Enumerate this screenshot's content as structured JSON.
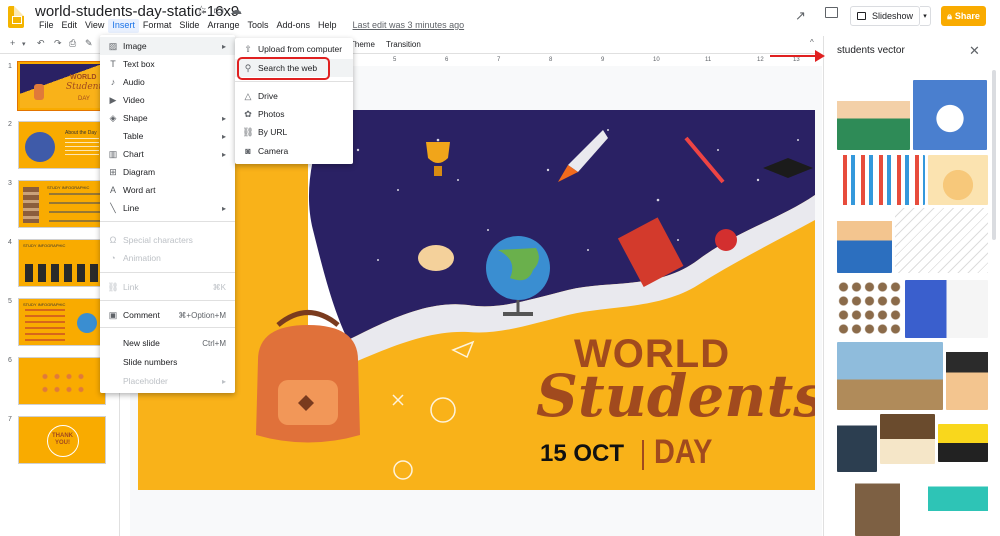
{
  "app": {
    "doc_title": "world-students-day-static-16x9",
    "last_edit": "Last edit was 3 minutes ago",
    "menus": [
      "File",
      "Edit",
      "View",
      "Insert",
      "Format",
      "Slide",
      "Arrange",
      "Tools",
      "Add-ons",
      "Help"
    ],
    "slideshow_label": "Slideshow",
    "share_label": "Share"
  },
  "toolbar": {
    "theme_label": "Theme",
    "transition_label": "Transition"
  },
  "ruler": [
    "5",
    "6",
    "7",
    "8",
    "9",
    "10",
    "11",
    "12",
    "13"
  ],
  "thumbnails": [
    {
      "num": "1",
      "text1": "WORLD",
      "text2": "Students",
      "text3": "DAY"
    },
    {
      "num": "2",
      "text1": "About the Day",
      "text2": "",
      "text3": ""
    },
    {
      "num": "3",
      "text1": "STUDY INFOGRAPHIC",
      "text2": "",
      "text3": ""
    },
    {
      "num": "4",
      "text1": "STUDY INFOGRAPHIC",
      "text2": "",
      "text3": ""
    },
    {
      "num": "5",
      "text1": "STUDY INFOGRAPHIC",
      "text2": "",
      "text3": ""
    },
    {
      "num": "6",
      "text1": "",
      "text2": "",
      "text3": ""
    },
    {
      "num": "7",
      "text1": "THANK",
      "text2": "YOU!",
      "text3": ""
    }
  ],
  "slide": {
    "title_line1": "WORLD",
    "title_line2": "Students",
    "date": "15 OCT",
    "day": "DAY"
  },
  "insert_menu": {
    "items": [
      {
        "label": "Image",
        "icon": "image-icon",
        "submenu": true,
        "highlighted": true
      },
      {
        "label": "Text box",
        "icon": "text-box-icon"
      },
      {
        "label": "Audio",
        "icon": "audio-icon"
      },
      {
        "label": "Video",
        "icon": "video-icon"
      },
      {
        "label": "Shape",
        "icon": "shape-icon",
        "submenu": true
      },
      {
        "label": "Table",
        "icon": "table-icon",
        "submenu": true
      },
      {
        "label": "Chart",
        "icon": "chart-icon",
        "submenu": true
      },
      {
        "label": "Diagram",
        "icon": "diagram-icon"
      },
      {
        "label": "Word art",
        "icon": "word-art-icon"
      },
      {
        "label": "Line",
        "icon": "line-icon",
        "submenu": true
      },
      {
        "label": "Special characters",
        "icon": "omega-icon",
        "disabled": true
      },
      {
        "label": "Animation",
        "icon": "animation-icon",
        "disabled": true
      },
      {
        "label": "Link",
        "icon": "link-icon",
        "disabled": true,
        "shortcut": "⌘K"
      },
      {
        "label": "Comment",
        "icon": "comment-icon",
        "shortcut": "⌘+Option+M"
      },
      {
        "label": "New slide",
        "shortcut": "Ctrl+M"
      },
      {
        "label": "Slide numbers"
      },
      {
        "label": "Placeholder",
        "disabled": true,
        "submenu": true
      }
    ]
  },
  "image_submenu": {
    "items": [
      {
        "label": "Upload from computer",
        "icon": "upload-icon"
      },
      {
        "label": "Search the web",
        "icon": "search-icon"
      },
      {
        "label": "Drive",
        "icon": "drive-icon"
      },
      {
        "label": "Photos",
        "icon": "photos-icon"
      },
      {
        "label": "By URL",
        "icon": "link-icon"
      },
      {
        "label": "Camera",
        "icon": "camera-icon"
      }
    ]
  },
  "panel": {
    "query": "students vector"
  },
  "colors": {
    "accent": "#f9ab00",
    "slide_bg": "#f9b219",
    "night": "#2a2164",
    "title_brown": "#a14a1e",
    "annotation_red": "#e02020"
  }
}
